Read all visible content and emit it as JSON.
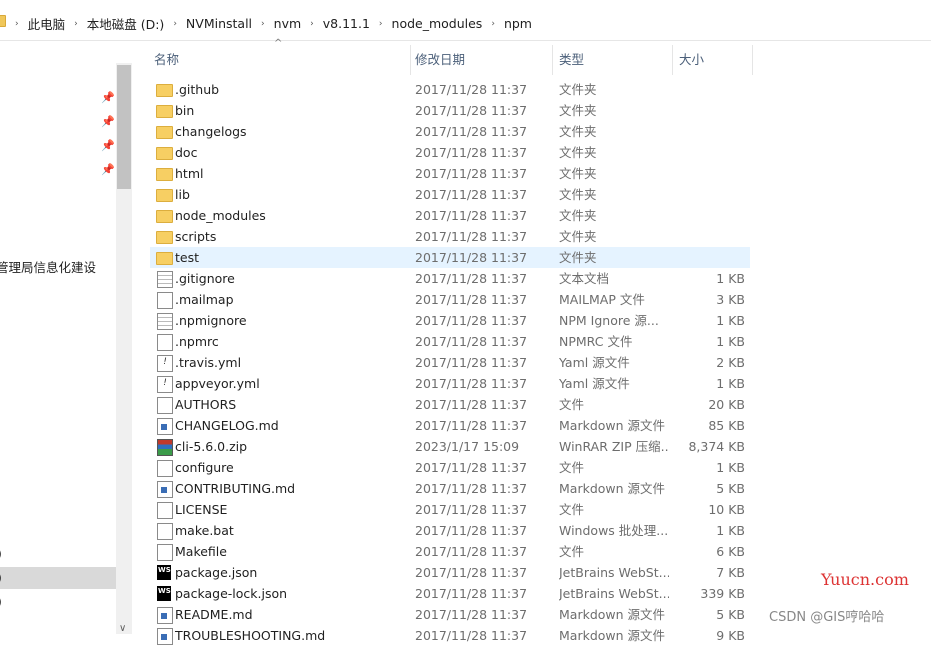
{
  "breadcrumb": [
    "此电脑",
    "本地磁盘 (D:)",
    "NVMinstall",
    "nvm",
    "v8.11.1",
    "node_modules",
    "npm"
  ],
  "nav": {
    "partial_item": "管理局信息化建设",
    "paren_items": [
      ")",
      ")",
      ")"
    ]
  },
  "columns": {
    "name": "名称",
    "date": "修改日期",
    "type": "类型",
    "size": "大小"
  },
  "files": [
    {
      "name": ".github",
      "date": "2017/11/28 11:37",
      "type": "文件夹",
      "size": "",
      "icon": "folder-icon"
    },
    {
      "name": "bin",
      "date": "2017/11/28 11:37",
      "type": "文件夹",
      "size": "",
      "icon": "folder-icon"
    },
    {
      "name": "changelogs",
      "date": "2017/11/28 11:37",
      "type": "文件夹",
      "size": "",
      "icon": "folder-icon"
    },
    {
      "name": "doc",
      "date": "2017/11/28 11:37",
      "type": "文件夹",
      "size": "",
      "icon": "folder-icon"
    },
    {
      "name": "html",
      "date": "2017/11/28 11:37",
      "type": "文件夹",
      "size": "",
      "icon": "folder-icon"
    },
    {
      "name": "lib",
      "date": "2017/11/28 11:37",
      "type": "文件夹",
      "size": "",
      "icon": "folder-icon"
    },
    {
      "name": "node_modules",
      "date": "2017/11/28 11:37",
      "type": "文件夹",
      "size": "",
      "icon": "folder-icon"
    },
    {
      "name": "scripts",
      "date": "2017/11/28 11:37",
      "type": "文件夹",
      "size": "",
      "icon": "folder-icon"
    },
    {
      "name": "test",
      "date": "2017/11/28 11:37",
      "type": "文件夹",
      "size": "",
      "icon": "folder-icon",
      "selected": true
    },
    {
      "name": ".gitignore",
      "date": "2017/11/28 11:37",
      "type": "文本文档",
      "size": "1 KB",
      "icon": "text-file-icon"
    },
    {
      "name": ".mailmap",
      "date": "2017/11/28 11:37",
      "type": "MAILMAP 文件",
      "size": "3 KB",
      "icon": "file-icon"
    },
    {
      "name": ".npmignore",
      "date": "2017/11/28 11:37",
      "type": "NPM Ignore 源...",
      "size": "1 KB",
      "icon": "text-file-icon"
    },
    {
      "name": ".npmrc",
      "date": "2017/11/28 11:37",
      "type": "NPMRC 文件",
      "size": "1 KB",
      "icon": "file-icon"
    },
    {
      "name": ".travis.yml",
      "date": "2017/11/28 11:37",
      "type": "Yaml 源文件",
      "size": "2 KB",
      "icon": "yaml-file-icon"
    },
    {
      "name": "appveyor.yml",
      "date": "2017/11/28 11:37",
      "type": "Yaml 源文件",
      "size": "1 KB",
      "icon": "yaml-file-icon"
    },
    {
      "name": "AUTHORS",
      "date": "2017/11/28 11:37",
      "type": "文件",
      "size": "20 KB",
      "icon": "file-icon"
    },
    {
      "name": "CHANGELOG.md",
      "date": "2017/11/28 11:37",
      "type": "Markdown 源文件",
      "size": "85 KB",
      "icon": "markdown-file-icon"
    },
    {
      "name": "cli-5.6.0.zip",
      "date": "2023/1/17 15:09",
      "type": "WinRAR ZIP 压缩...",
      "size": "8,374 KB",
      "icon": "zip-file-icon"
    },
    {
      "name": "configure",
      "date": "2017/11/28 11:37",
      "type": "文件",
      "size": "1 KB",
      "icon": "file-icon"
    },
    {
      "name": "CONTRIBUTING.md",
      "date": "2017/11/28 11:37",
      "type": "Markdown 源文件",
      "size": "5 KB",
      "icon": "markdown-file-icon"
    },
    {
      "name": "LICENSE",
      "date": "2017/11/28 11:37",
      "type": "文件",
      "size": "10 KB",
      "icon": "file-icon"
    },
    {
      "name": "make.bat",
      "date": "2017/11/28 11:37",
      "type": "Windows 批处理...",
      "size": "1 KB",
      "icon": "batch-file-icon"
    },
    {
      "name": "Makefile",
      "date": "2017/11/28 11:37",
      "type": "文件",
      "size": "6 KB",
      "icon": "file-icon"
    },
    {
      "name": "package.json",
      "date": "2017/11/28 11:37",
      "type": "JetBrains WebSt...",
      "size": "7 KB",
      "icon": "webstorm-file-icon"
    },
    {
      "name": "package-lock.json",
      "date": "2017/11/28 11:37",
      "type": "JetBrains WebSt...",
      "size": "339 KB",
      "icon": "webstorm-file-icon"
    },
    {
      "name": "README.md",
      "date": "2017/11/28 11:37",
      "type": "Markdown 源文件",
      "size": "5 KB",
      "icon": "markdown-file-icon"
    },
    {
      "name": "TROUBLESHOOTING.md",
      "date": "2017/11/28 11:37",
      "type": "Markdown 源文件",
      "size": "9 KB",
      "icon": "markdown-file-icon"
    }
  ],
  "watermarks": {
    "site": "Yuucn.com",
    "csdn": "CSDN @GIS哼哈哈"
  }
}
